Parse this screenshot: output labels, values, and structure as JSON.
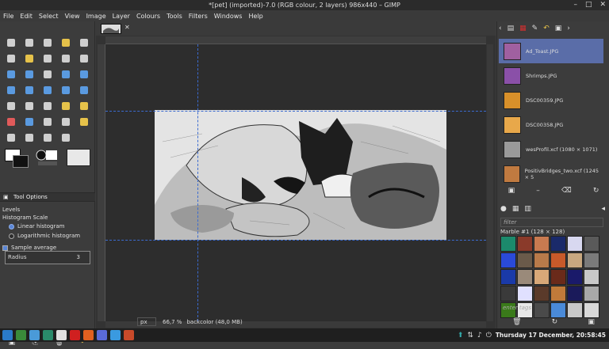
{
  "window": {
    "title": "*[pet] (imported)-7.0 (RGB colour, 2 layers) 986x440 – GIMP"
  },
  "menu": [
    "File",
    "Edit",
    "Select",
    "View",
    "Image",
    "Layer",
    "Colours",
    "Tools",
    "Filters",
    "Windows",
    "Help"
  ],
  "toolbox": {
    "tools": [
      {
        "name": "rect-select-icon",
        "color": "#cfcfcf"
      },
      {
        "name": "ellipse-select-icon",
        "color": "#cfcfcf"
      },
      {
        "name": "free-select-icon",
        "color": "#cfcfcf"
      },
      {
        "name": "fuzzy-select-icon",
        "color": "#e6c24a"
      },
      {
        "name": "zoom-icon",
        "color": "#cfcfcf"
      },
      {
        "name": "scissors-icon",
        "color": "#cfcfcf"
      },
      {
        "name": "foreground-select-icon",
        "color": "#e6c24a"
      },
      {
        "name": "paths-icon",
        "color": "#cfcfcf"
      },
      {
        "name": "color-picker-icon",
        "color": "#cfcfcf"
      },
      {
        "name": "measure-icon",
        "color": "#cfcfcf"
      },
      {
        "name": "align-icon",
        "color": "#5a9ae0"
      },
      {
        "name": "move-icon",
        "color": "#5a9ae0"
      },
      {
        "name": "crop-icon",
        "color": "#cfcfcf"
      },
      {
        "name": "rotate-icon",
        "color": "#5a9ae0"
      },
      {
        "name": "scale-icon",
        "color": "#5a9ae0"
      },
      {
        "name": "shear-icon",
        "color": "#5a9ae0"
      },
      {
        "name": "perspective-icon",
        "color": "#5a9ae0"
      },
      {
        "name": "unified-transform-icon",
        "color": "#5a9ae0"
      },
      {
        "name": "flip-icon",
        "color": "#5a9ae0"
      },
      {
        "name": "cage-icon",
        "color": "#5a9ae0"
      },
      {
        "name": "text-icon",
        "color": "#cfcfcf"
      },
      {
        "name": "bucket-fill-icon",
        "color": "#cfcfcf"
      },
      {
        "name": "blend-icon",
        "color": "#cfcfcf"
      },
      {
        "name": "pencil-icon",
        "color": "#e6c24a"
      },
      {
        "name": "paintbrush-icon",
        "color": "#e6c24a"
      },
      {
        "name": "eraser-icon",
        "color": "#e05a5a"
      },
      {
        "name": "airbrush-icon",
        "color": "#5a9ae0"
      },
      {
        "name": "ink-icon",
        "color": "#cfcfcf"
      },
      {
        "name": "clone-icon",
        "color": "#cfcfcf"
      },
      {
        "name": "heal-icon",
        "color": "#e6c24a"
      },
      {
        "name": "smudge-icon",
        "color": "#cfcfcf"
      },
      {
        "name": "dodge-burn-icon",
        "color": "#cfcfcf"
      },
      {
        "name": "blur-icon",
        "color": "#cfcfcf"
      },
      {
        "name": "mypaint-icon",
        "color": "#cfcfcf"
      }
    ]
  },
  "tool_options": {
    "tab_label": "Tool Options",
    "heading": "Levels",
    "scale_label": "Histogram Scale",
    "linear": "Linear histogram",
    "log": "Logarithmic histogram",
    "sample_average": "Sample average",
    "radius_label": "Radius",
    "radius_value": "3"
  },
  "statusbar": {
    "unit": "px",
    "zoom": "66,7 %",
    "layer_info": "backcolor (48,0 MB)"
  },
  "images": [
    {
      "name": "Ad_Toast.JPG",
      "color": "#a060a0",
      "selected": true
    },
    {
      "name": "Shrimps.JPG",
      "color": "#8a50a8",
      "selected": false
    },
    {
      "name": "DSC00359.JPG",
      "color": "#d8902a",
      "selected": false
    },
    {
      "name": "DSC00358.JPG",
      "color": "#e8a84a",
      "selected": false
    },
    {
      "name": "wesProfil.xcf (1080 × 1071)",
      "color": "#9a9a9a",
      "selected": false
    },
    {
      "name": "PositivBridges_two.xcf (1245 × 5",
      "color": "#c07a40",
      "selected": false
    }
  ],
  "patterns_panel": {
    "filter_placeholder": "filter",
    "selected_label": "Marble #1 (128 × 128)",
    "tags_placeholder": "enter tags",
    "swatches": [
      "#1c8a6c",
      "#8a3a2a",
      "#c87a50",
      "#1a2a6a",
      "#d8d8f0",
      "#5a5a5a",
      "#2a4ad8",
      "#6a5a4a",
      "#b87a4a",
      "#c85a2a",
      "#c8a880",
      "#7a7a7a",
      "#1a3aa8",
      "#9a8a7a",
      "#d8a878",
      "#6a2a1a",
      "#1a1a6a",
      "#c8c8c8",
      "#3a3a3a",
      "#e0e0ff",
      "#5a3a2a",
      "#c07a3a",
      "#1a1a5a",
      "#a8a8a8",
      "#3a7a1a",
      "#e8e8e8",
      "#4a4a4a",
      "#4a8ad8",
      "#c8c8c8",
      "#d8d8d8"
    ]
  },
  "clock": "Thursday 17 December, 20:58:45",
  "taskbar_apps": [
    "#2a7ac8",
    "#3a8a3a",
    "#4a9ad8",
    "#2a8a6a",
    "#e0e0e0",
    "#d02020",
    "#e06020",
    "#5a6ad8",
    "#3a9ae0",
    "#c84a2a"
  ]
}
